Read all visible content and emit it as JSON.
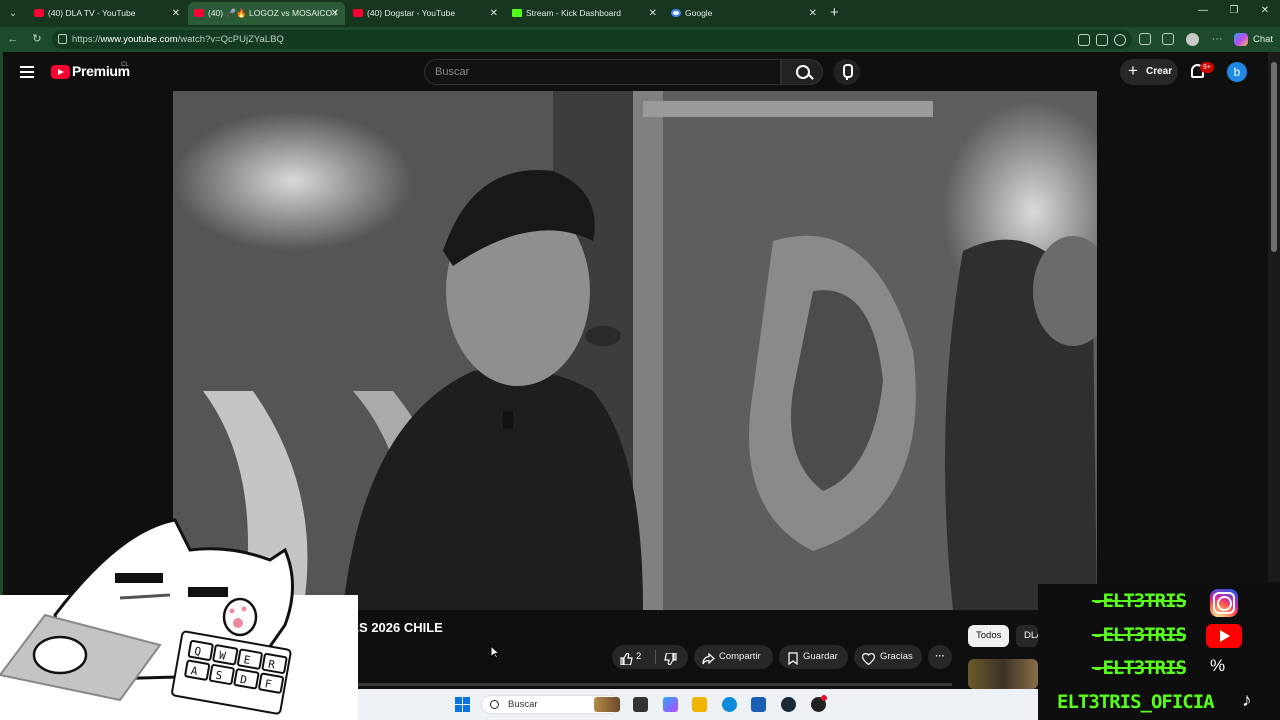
{
  "browser": {
    "tabs": [
      {
        "title": "(40) DLA TV - YouTube",
        "icon": "youtube-icon",
        "active": false
      },
      {
        "title": "(40) 🎤🔥 LOGOZ vs MOSAICO /",
        "icon": "youtube-icon",
        "active": true
      },
      {
        "title": "(40) Dogstar - YouTube",
        "icon": "youtube-icon",
        "active": false
      },
      {
        "title": "Stream - Kick Dashboard",
        "icon": "kick-icon",
        "active": false
      },
      {
        "title": "Google",
        "icon": "google-icon",
        "active": false
      }
    ],
    "url_prefix": "https://",
    "url_host": "www.youtube.com",
    "url_path": "/watch?v=QcPUjZYaLBQ",
    "chat_label": "Chat"
  },
  "youtube": {
    "brand": "Premium",
    "country": "CL",
    "search_placeholder": "Buscar",
    "create_label": "Crear",
    "notifications": "9+",
    "avatar_letter": "b",
    "video_title_visible": "S Y BARRAS 2026 CHILE",
    "likes": "2",
    "share_label": "Compartir",
    "save_label": "Guardar",
    "thanks_label": "Gracias",
    "chip_all": "Todos",
    "chip_dla": "DLA"
  },
  "taskbar": {
    "search_placeholder": "Buscar"
  },
  "overlay": {
    "handles": [
      "-ELT3TRIS",
      "-ELT3TRIS",
      "-ELT3TRIS",
      "ELT3TRIS_OFICIA"
    ],
    "keyboard_keys": [
      "Q",
      "W",
      "E",
      "R",
      "A",
      "S",
      "D",
      "F"
    ]
  },
  "colors": {
    "browser_frame": "#16361f",
    "youtube_red": "#ff0033",
    "overlay_green": "#57ff1a"
  }
}
